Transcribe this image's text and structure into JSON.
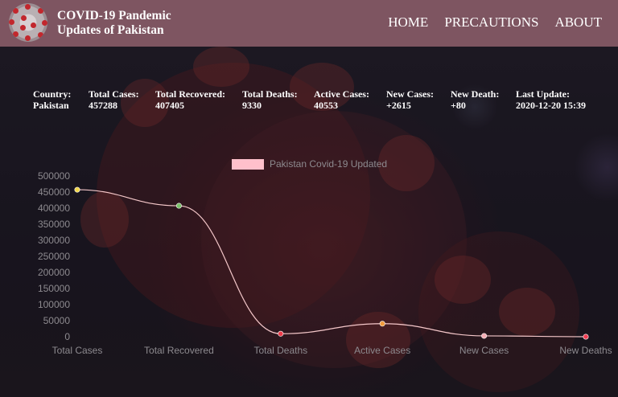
{
  "header": {
    "title_line1": "COVID-19 Pandemic",
    "title_line2": "Updates of Pakistan",
    "nav": [
      {
        "label": "HOME"
      },
      {
        "label": "PRECAUTIONS"
      },
      {
        "label": "ABOUT"
      }
    ]
  },
  "stats": [
    {
      "label": "Country:",
      "value": "Pakistan"
    },
    {
      "label": "Total Cases:",
      "value": "457288"
    },
    {
      "label": "Total Recovered:",
      "value": "407405"
    },
    {
      "label": "Total Deaths:",
      "value": "9330"
    },
    {
      "label": "Active Cases:",
      "value": "40553"
    },
    {
      "label": "New Cases:",
      "value": "+2615"
    },
    {
      "label": "New Death:",
      "value": "+80"
    },
    {
      "label": "Last Update:",
      "value": "2020-12-20 15:39"
    }
  ],
  "colors": {
    "header_bg": "#7e5561",
    "line": "#f4c7c9",
    "legend_box": "#ffc0cb",
    "axis_text": "#8d8a8f"
  },
  "chart_data": {
    "type": "line",
    "legend": "Pakistan Covid-19 Updated",
    "legend_position": "top-center",
    "categories": [
      "Total Cases",
      "Total Recovered",
      "Total Deaths",
      "Active Cases",
      "New Cases",
      "New Deaths"
    ],
    "series": [
      {
        "name": "Pakistan Covid-19 Updated",
        "values": [
          457288,
          407405,
          9330,
          40553,
          2615,
          80
        ],
        "point_colors": [
          "#f2d64a",
          "#7bc26a",
          "#ec3b4a",
          "#f29b3c",
          "#f4aeb5",
          "#ef3d52"
        ]
      }
    ],
    "yticks": [
      500000,
      450000,
      400000,
      350000,
      300000,
      250000,
      200000,
      150000,
      100000,
      50000,
      0
    ],
    "ylim": [
      0,
      500000
    ],
    "grid": false
  }
}
